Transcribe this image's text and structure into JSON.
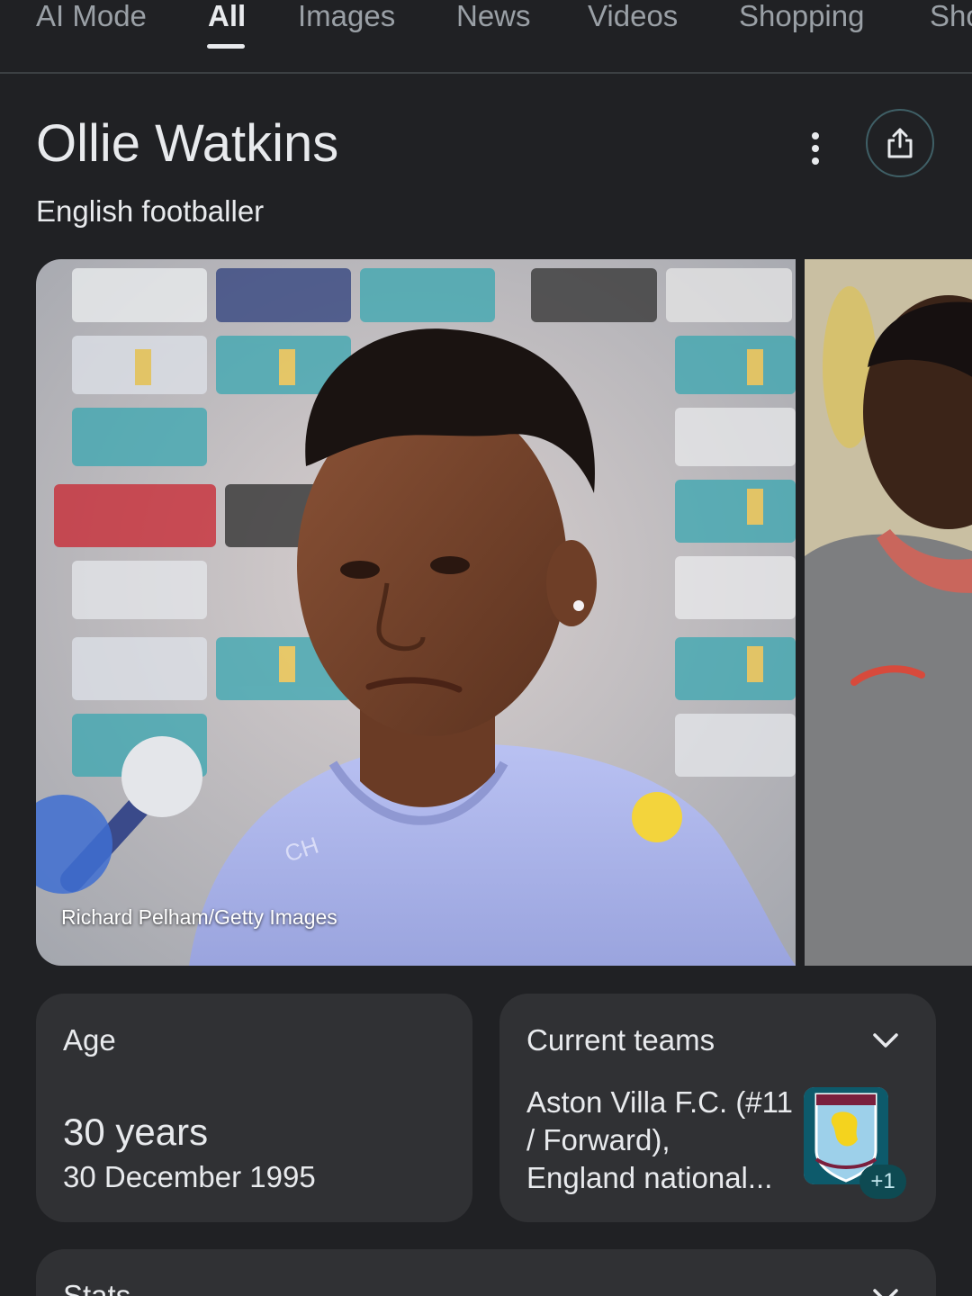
{
  "tabs": [
    {
      "label": "AI Mode"
    },
    {
      "label": "All"
    },
    {
      "label": "Images"
    },
    {
      "label": "News"
    },
    {
      "label": "Videos"
    },
    {
      "label": "Shopping"
    },
    {
      "label": "Sho"
    }
  ],
  "active_tab": "All",
  "entity": {
    "title": "Ollie Watkins",
    "subtitle": "English footballer"
  },
  "image": {
    "credit": "Richard Pelham/Getty Images"
  },
  "age_card": {
    "label": "Age",
    "value": "30 years",
    "birth_date": "30 December 1995"
  },
  "teams_card": {
    "label": "Current teams",
    "line1": "Aston Villa F.C. (#11",
    "line2": "/ Forward),",
    "line3": "England national...",
    "more_count": "+1"
  },
  "stats_card": {
    "label": "Stats"
  },
  "icons": {
    "more": "more-vert-icon",
    "share": "share-icon",
    "expand": "chevron-down-icon"
  },
  "colors": {
    "background": "#202124",
    "card": "#303134",
    "text": "#e8eaed",
    "muted": "#9aa0a6",
    "badge": "#0e4a52"
  }
}
